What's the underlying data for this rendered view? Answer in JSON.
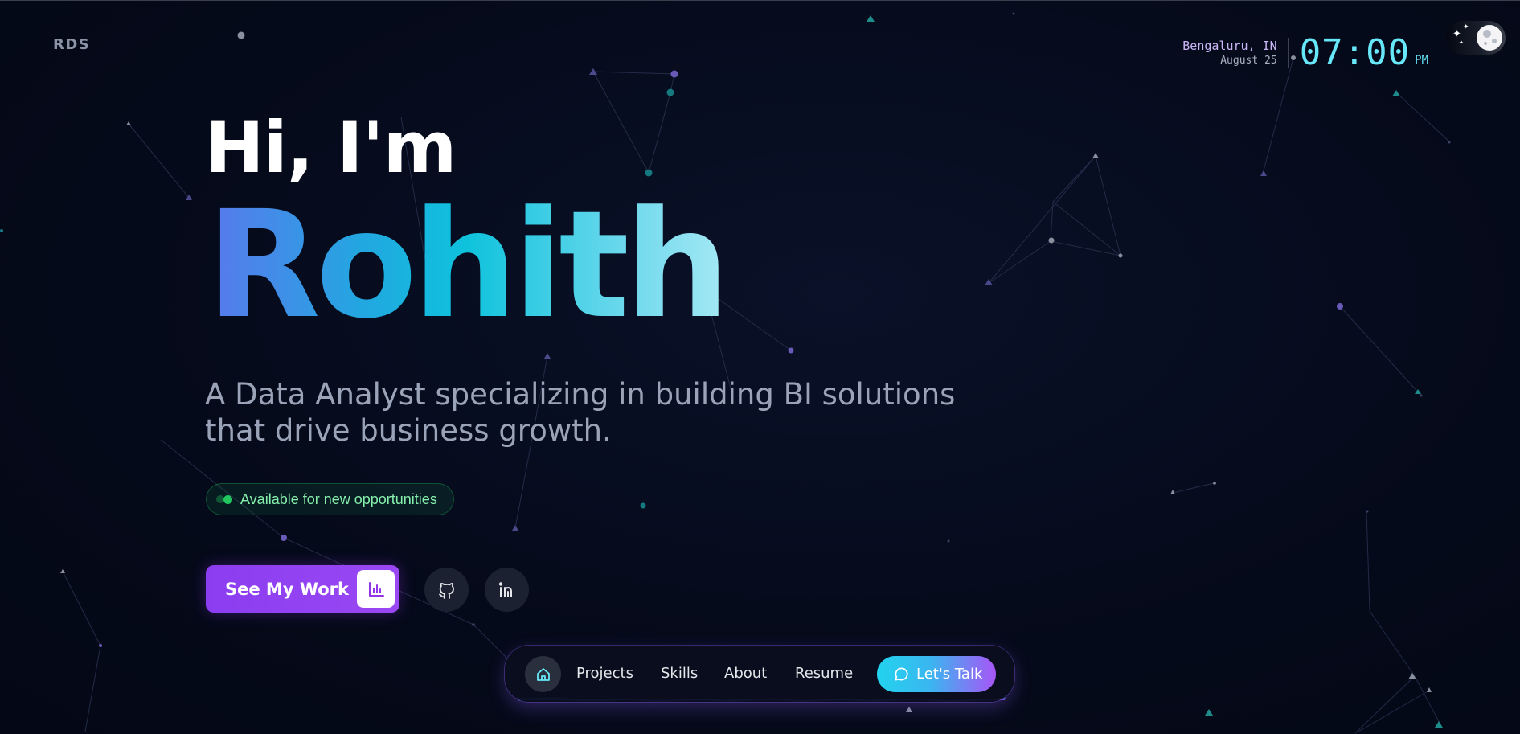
{
  "header": {
    "logo": "RDS",
    "clock": {
      "location": "Bengaluru, IN",
      "date": "August 25",
      "time": "07:00",
      "ampm": "PM"
    },
    "theme_toggle_icon": "moon-stars-icon"
  },
  "hero": {
    "greeting": "Hi, I'm",
    "name": "Rohith",
    "tagline_line1": "A Data Analyst specializing in building BI solutions",
    "tagline_line2": "that drive business growth.",
    "status": "Available for new opportunities",
    "cta_label": "See My Work",
    "cta_icon": "bar-chart-icon",
    "social": [
      {
        "icon": "github-icon"
      },
      {
        "icon": "linkedin-icon"
      }
    ]
  },
  "nav": {
    "home_icon": "home-icon",
    "links": [
      "Projects",
      "Skills",
      "About",
      "Resume"
    ],
    "cta_label": "Let's Talk",
    "cta_icon": "chat-bubble-icon"
  },
  "colors": {
    "background": "#050a1a",
    "accent_cyan": "#22d3ee",
    "accent_purple": "#9333ea",
    "status_green": "#22c55e"
  }
}
